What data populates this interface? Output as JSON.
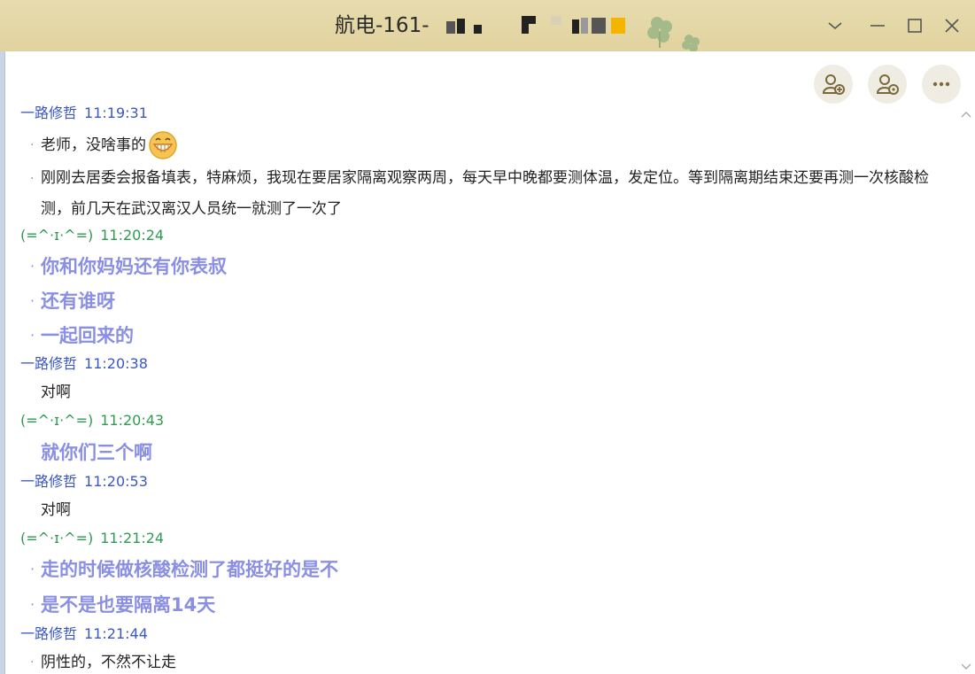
{
  "window": {
    "title": "航电-161-"
  },
  "colors": {
    "titlebar": "#e1d39f",
    "sender_me": "#3a56c7",
    "sender_other": "#2e9b52",
    "highlight_text": "#8a8fe4"
  },
  "messages": [
    {
      "sender": "一路修哲",
      "time": "11:19:31",
      "lines": [
        "老师，没啥事的",
        "刚刚去居委会报备填表，特麻烦，我现在要居家隔离观察两周，每天早中晚都要测体温，发定位。等到隔离期结束还要再测一次核酸检测，前几天在武汉离汉人员统一就测了一次了"
      ]
    },
    {
      "sender": "(=^·ɪ·^=)",
      "time": "11:20:24",
      "lines": [
        "你和你妈妈还有你表叔",
        "还有谁呀",
        "一起回来的"
      ]
    },
    {
      "sender": "一路修哲",
      "time": "11:20:38",
      "lines": [
        "对啊"
      ]
    },
    {
      "sender": "(=^·ɪ·^=)",
      "time": "11:20:43",
      "lines": [
        "就你们三个啊"
      ]
    },
    {
      "sender": "一路修哲",
      "time": "11:20:53",
      "lines": [
        "对啊"
      ]
    },
    {
      "sender": "(=^·ɪ·^=)",
      "time": "11:21:24",
      "lines": [
        "走的时候做核酸检测了都挺好的是不",
        "是不是也要隔离14天"
      ]
    },
    {
      "sender": "一路修哲",
      "time": "11:21:44",
      "lines": [
        "阴性的，不然不让走"
      ]
    }
  ],
  "icons": {
    "emoji": "grinning-face-icon",
    "top_buttons": [
      "add-person-icon",
      "person-settings-icon",
      "more-icon"
    ],
    "window_controls": [
      "chevron-down-icon",
      "minimize-icon",
      "maximize-icon",
      "close-icon"
    ]
  }
}
